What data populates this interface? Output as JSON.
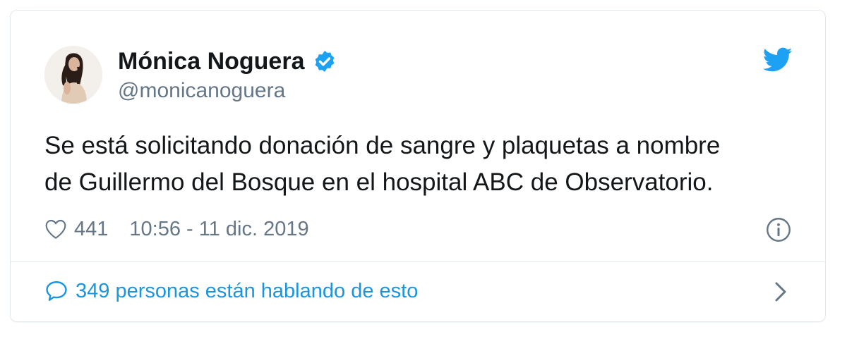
{
  "author": {
    "name": "Mónica Noguera",
    "handle": "@monicanoguera",
    "verified": true
  },
  "tweet": {
    "text_line1": "Se está solicitando donación de sangre y plaquetas a nombre",
    "text_line2": "de Guillermo del Bosque en el hospital ABC de Observatorio.",
    "likes": "441",
    "timestamp": "10:56 - 11 dic. 2019"
  },
  "conversation": {
    "label": "349 personas están hablando de esto"
  },
  "icons": {
    "brand": "twitter-bird-icon",
    "verified": "verified-badge-icon",
    "like": "heart-icon",
    "info": "info-icon",
    "reply": "speech-bubble-icon",
    "more": "chevron-right-icon"
  },
  "colors": {
    "accent": "#1da1f2",
    "link": "#1b95e0",
    "text": "#14171a",
    "secondary": "#657786",
    "border": "#e1e8ed"
  }
}
